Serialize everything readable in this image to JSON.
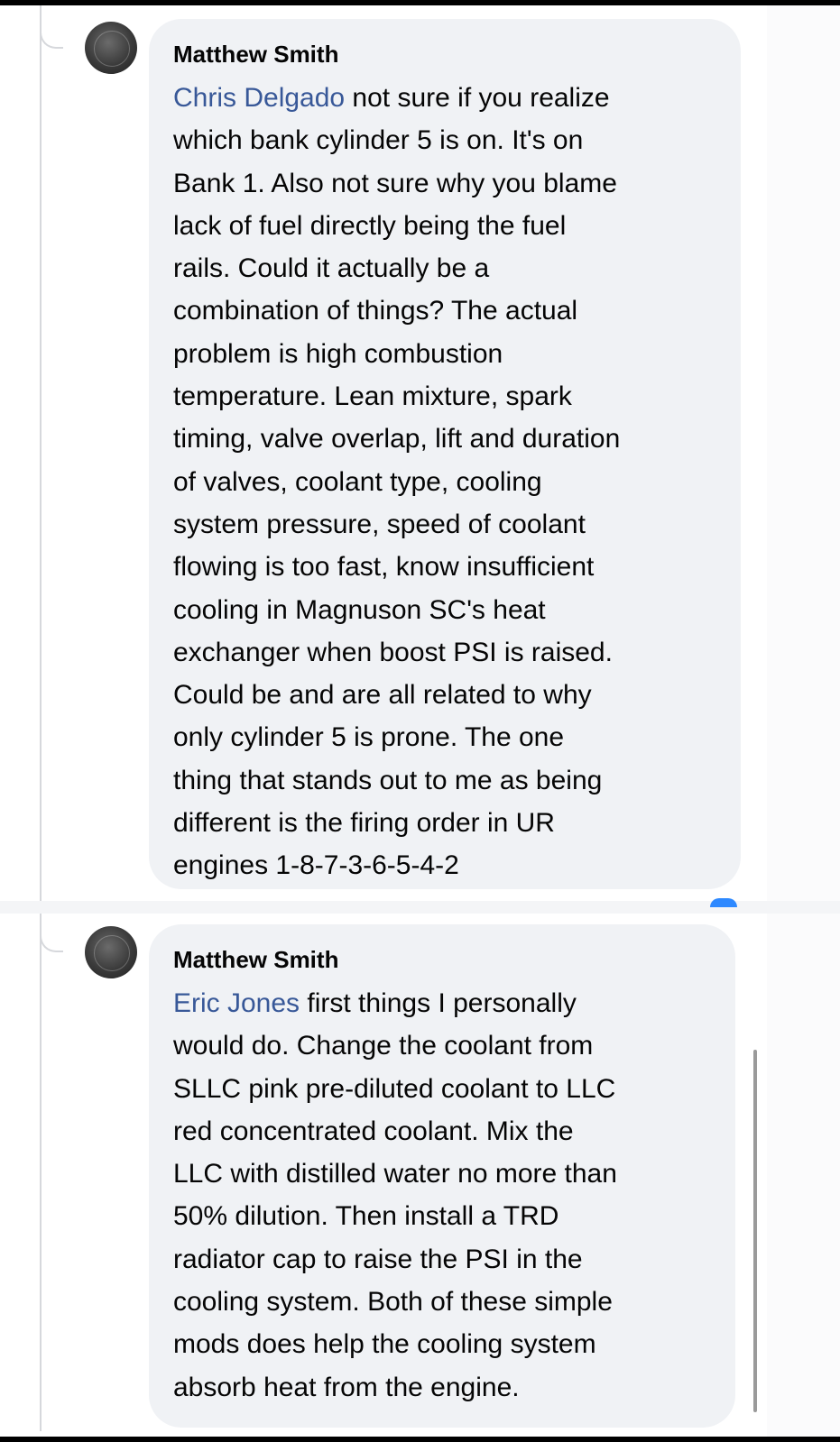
{
  "comments": [
    {
      "author": "Matthew Smith",
      "mention": "Chris Delgado",
      "text": " not sure if you realize\nwhich bank cylinder 5 is on. It's on\nBank 1. Also not sure why you blame\nlack of fuel directly being the fuel\nrails. Could it actually be a\ncombination of things? The actual\nproblem is high combustion\ntemperature. Lean mixture, spark\ntiming, valve overlap, lift and duration\nof valves, coolant type, cooling\nsystem pressure, speed of coolant\nflowing is too fast, know insufficient\ncooling in Magnuson SC's heat\nexchanger when boost PSI is raised.\nCould be and are all related to why\nonly cylinder 5 is prone. The one\nthing that stands out to me as being\ndifferent is the firing order in UR\nengines 1-8-7-3-6-5-4-2"
    },
    {
      "author": "Matthew Smith",
      "mention": "Eric Jones",
      "text": " first things I personally\nwould do. Change the coolant from\nSLLC pink pre-diluted coolant to LLC\nred concentrated coolant. Mix the\nLLC with distilled water no more than\n50% dilution. Then install a TRD\nradiator cap to raise the PSI in the\ncooling system. Both of these simple\nmods does help the cooling system\nabsorb  heat from the engine."
    }
  ],
  "colors": {
    "bubble_bg": "#f0f2f5",
    "mention": "#385898",
    "text": "#050505"
  }
}
